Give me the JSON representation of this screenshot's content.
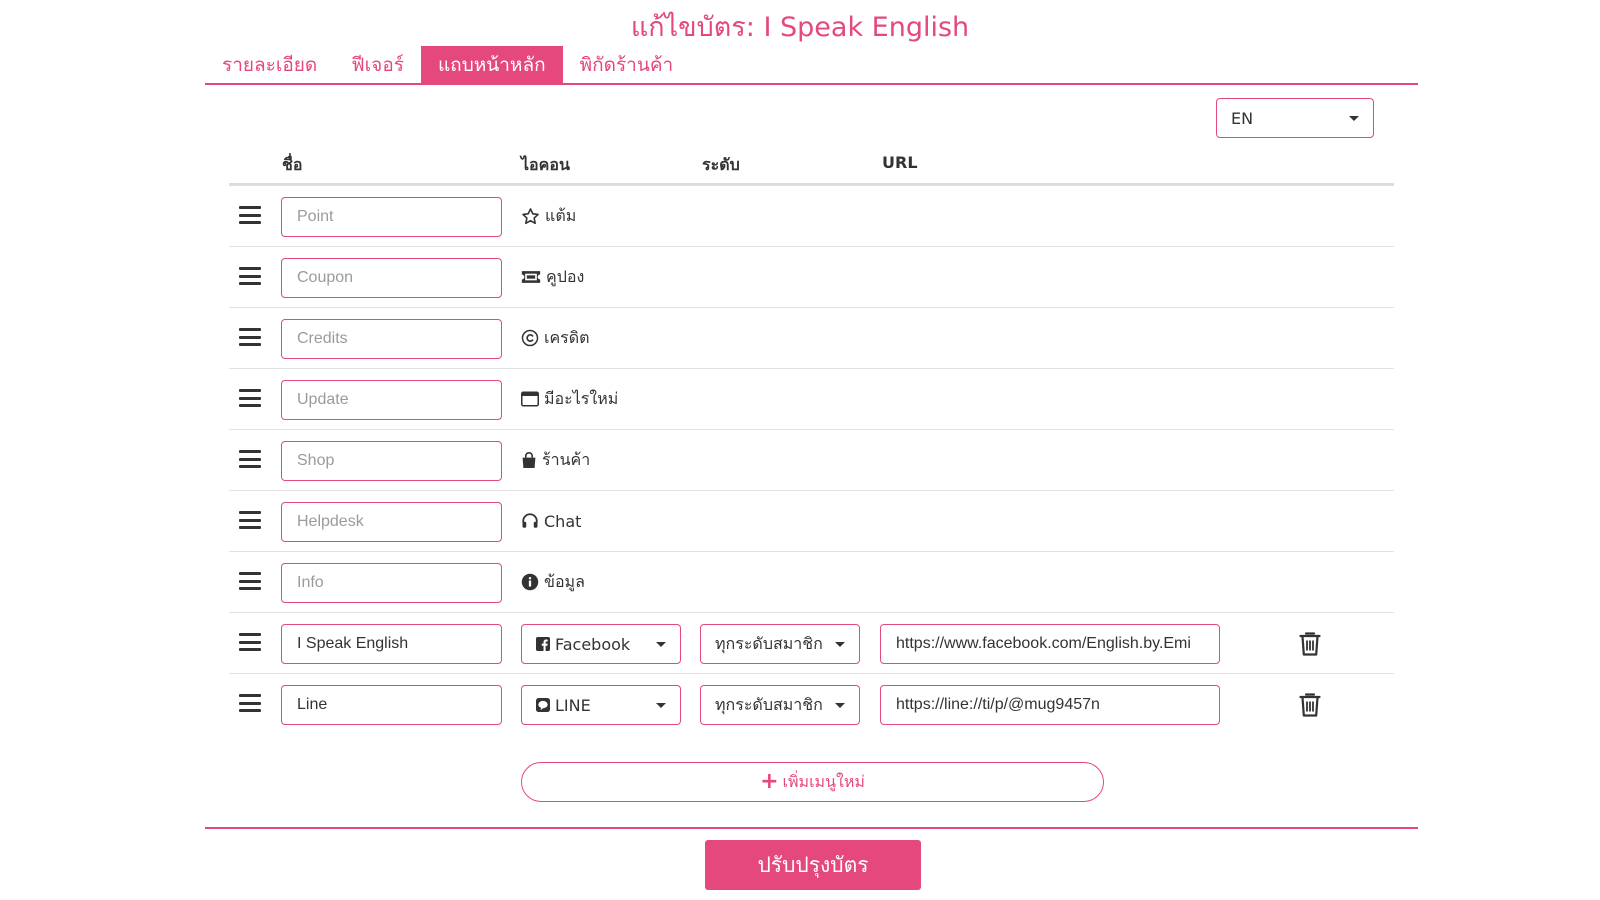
{
  "page": {
    "title": "แก้ไขบัตร: I Speak English"
  },
  "tabs": [
    {
      "label": "รายละเอียด"
    },
    {
      "label": "ฟีเจอร์"
    },
    {
      "label": "แถบหน้าหลัก"
    },
    {
      "label": "พิกัดร้านค้า"
    }
  ],
  "active_tab": "แถบหน้าหลัก",
  "language": {
    "selected": "EN"
  },
  "columns": {
    "name": "ชื่อ",
    "icon": "ไอคอน",
    "level": "ระดับ",
    "url": "URL"
  },
  "menu_items": [
    {
      "placeholder": "Point",
      "icon": "star-icon",
      "icon_label": "แต้ม"
    },
    {
      "placeholder": "Coupon",
      "icon": "ticket-icon",
      "icon_label": "คูปอง"
    },
    {
      "placeholder": "Credits",
      "icon": "copyright-icon",
      "icon_label": "เครดิต"
    },
    {
      "placeholder": "Update",
      "icon": "window-icon",
      "icon_label": "มีอะไรใหม่"
    },
    {
      "placeholder": "Shop",
      "icon": "shopping-bag-icon",
      "icon_label": "ร้านค้า"
    },
    {
      "placeholder": "Helpdesk",
      "icon": "headset-icon",
      "icon_label": "Chat"
    },
    {
      "placeholder": "Info",
      "icon": "info-icon",
      "icon_label": "ข้อมูล"
    }
  ],
  "custom_items": [
    {
      "name": "I Speak English",
      "icon": "facebook-icon",
      "icon_select": "Facebook",
      "level": "ทุกระดับสมาชิก",
      "url": "https://www.facebook.com/English.by.Emi"
    },
    {
      "name": "Line",
      "icon": "line-icon",
      "icon_select": "LINE",
      "level": "ทุกระดับสมาชิก",
      "url": "https://line://ti/p/@mug9457n"
    }
  ],
  "actions": {
    "add_menu": "เพิ่มเมนูใหม่",
    "submit": "ปรับปรุงบัตร"
  },
  "colors": {
    "accent": "#e4487d"
  }
}
